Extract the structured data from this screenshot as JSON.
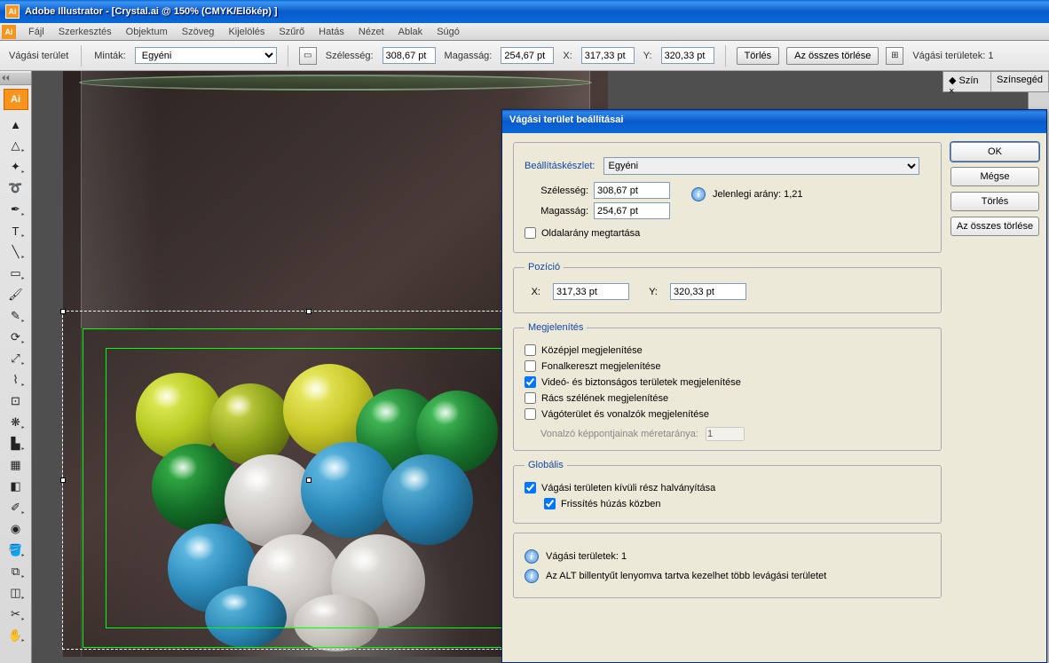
{
  "titlebar": {
    "app": "Adobe Illustrator",
    "doc": "[Crystal.ai @ 150% (CMYK/Előkép) ]"
  },
  "menu": [
    "Fájl",
    "Szerkesztés",
    "Objektum",
    "Szöveg",
    "Kijelölés",
    "Szűrő",
    "Hatás",
    "Nézet",
    "Ablak",
    "Súgó"
  ],
  "controlbar": {
    "area_label": "Vágási terület",
    "presets_label": "Minták:",
    "preset_value": "Egyéni",
    "width_label": "Szélesség:",
    "width_value": "308,67 pt",
    "height_label": "Magasság:",
    "height_value": "254,67 pt",
    "x_label": "X:",
    "x_value": "317,33 pt",
    "y_label": "Y:",
    "y_value": "320,33 pt",
    "delete": "Törlés",
    "delete_all": "Az összes törlése",
    "count": "Vágási területek: 1"
  },
  "right_tabs": [
    "Szín",
    "Színsegéd"
  ],
  "dialog": {
    "title": "Vágási terület beállításai",
    "preset_label": "Beállításkészlet:",
    "preset_value": "Egyéni",
    "width_label": "Szélesség:",
    "width_value": "308,67 pt",
    "height_label": "Magasság:",
    "height_value": "254,67 pt",
    "ratio_text": "Jelenlegi arány: 1,21",
    "keep_aspect": "Oldalarány megtartása",
    "pos_legend": "Pozíció",
    "x_label": "X:",
    "x_value": "317,33 pt",
    "y_label": "Y:",
    "y_value": "320,33 pt",
    "disp_legend": "Megjelenítés",
    "disp_center": "Középjel megjelenítése",
    "disp_cross": "Fonalkereszt megjelenítése",
    "disp_safe": "Videó- és biztonságos területek megjelenítése",
    "disp_grid": "Rács szélének megjelenítése",
    "disp_rulers": "Vágóterület és vonalzók megjelenítése",
    "ruler_label": "Vonalzó képpontjainak méretaránya:",
    "ruler_value": "1",
    "global_legend": "Globális",
    "global_fade": "Vágási területen kívüli rész halványítása",
    "global_update": "Frissítés húzás közben",
    "info_count": "Vágási területek: 1",
    "info_alt": "Az ALT billentyűt lenyomva tartva kezelhet több levágási területet",
    "btn_ok": "OK",
    "btn_cancel": "Mégse",
    "btn_delete": "Törlés",
    "btn_delete_all": "Az összes törlése"
  }
}
